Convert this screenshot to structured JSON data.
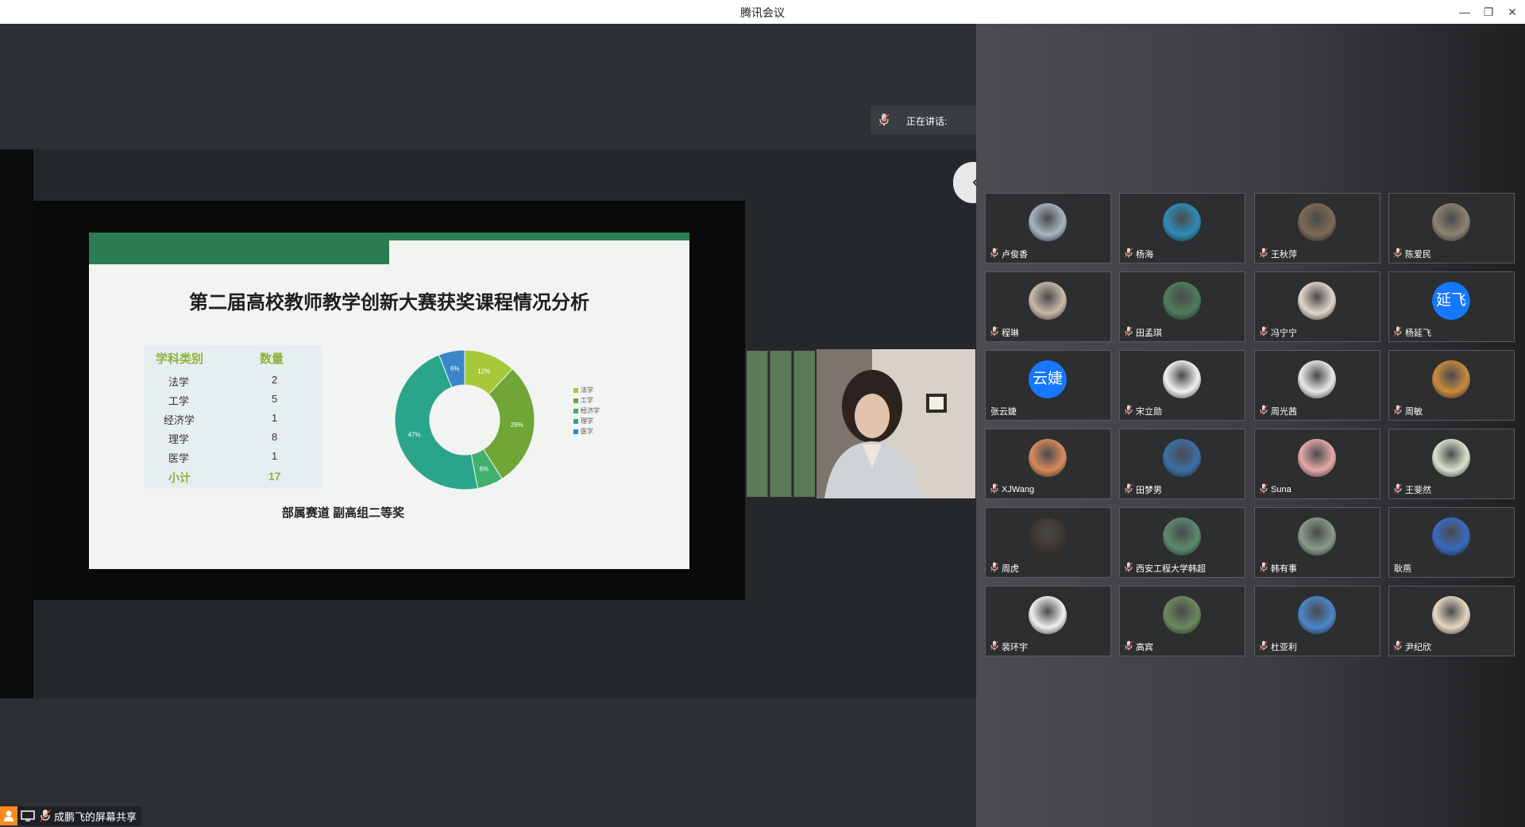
{
  "window": {
    "title": "腾讯会议",
    "minimize": "—",
    "restore": "❐",
    "close": "✕"
  },
  "speaking": {
    "label": "正在讲话:"
  },
  "slide": {
    "title": "第二届高校教师教学创新大赛获奖课程情况分析",
    "table": {
      "headers": [
        "学科类别",
        "数量"
      ],
      "rows": [
        [
          "法学",
          "2"
        ],
        [
          "工学",
          "5"
        ],
        [
          "经济学",
          "1"
        ],
        [
          "理学",
          "8"
        ],
        [
          "医学",
          "1"
        ]
      ],
      "total": [
        "小计",
        "17"
      ]
    },
    "caption": "部属赛道 副高组二等奖"
  },
  "chart_data": {
    "type": "pie",
    "categories": [
      "法学",
      "工学",
      "经济学",
      "理学",
      "医学"
    ],
    "values": [
      12,
      29,
      6,
      47,
      6
    ],
    "slice_labels": [
      "12%",
      "29%",
      "6%",
      "47%",
      "6%"
    ],
    "legend": [
      "法学",
      "工学",
      "经济学",
      "理学",
      "医学"
    ],
    "colors": [
      "#a6c93a",
      "#6fa636",
      "#3fb06e",
      "#2aa58b",
      "#3a86c8"
    ]
  },
  "participants": [
    {
      "name": "卢俊香",
      "avatar": "photo-icon",
      "color": "#a9b4c0",
      "mic": true
    },
    {
      "name": "杨海",
      "avatar": "photo-icon",
      "color": "#2f8db8",
      "mic": true
    },
    {
      "name": "王秋萍",
      "avatar": "photo-icon",
      "color": "#7d6a55",
      "mic": true
    },
    {
      "name": "陈爱民",
      "avatar": "photo-icon",
      "color": "#8e8272",
      "mic": true
    },
    {
      "name": "程琳",
      "avatar": "photo-icon",
      "color": "#c9b9a8",
      "mic": true
    },
    {
      "name": "田孟琪",
      "avatar": "photo-icon",
      "color": "#4f7c5a",
      "mic": true
    },
    {
      "name": "冯宁宁",
      "avatar": "photo-icon",
      "color": "#e2d6cc",
      "mic": true
    },
    {
      "name": "杨延飞",
      "avatar": "text",
      "text": "延飞",
      "color": "#1677ff",
      "mic": true
    },
    {
      "name": "张云婕",
      "avatar": "text",
      "text": "云婕",
      "color": "#1677ff",
      "mic": false
    },
    {
      "name": "宋立勋",
      "avatar": "photo-icon",
      "color": "#f1f1f1",
      "mic": true
    },
    {
      "name": "周光茜",
      "avatar": "photo-icon",
      "color": "#e9e9e9",
      "mic": true
    },
    {
      "name": "周敏",
      "avatar": "photo-icon",
      "color": "#c98a3f",
      "mic": true
    },
    {
      "name": "XJWang",
      "avatar": "photo-icon",
      "color": "#d98a5b",
      "mic": true
    },
    {
      "name": "田梦男",
      "avatar": "photo-icon",
      "color": "#3c6fa6",
      "mic": true
    },
    {
      "name": "Suna",
      "avatar": "photo-icon",
      "color": "#e8a8a8",
      "mic": true
    },
    {
      "name": "王斐然",
      "avatar": "photo-icon",
      "color": "#d9e4cc",
      "mic": true
    },
    {
      "name": "周虎",
      "avatar": "photo-icon",
      "color": "#3b3530",
      "mic": true
    },
    {
      "name": "西安工程大学韩超",
      "avatar": "photo-icon",
      "color": "#5e8a6e",
      "mic": true
    },
    {
      "name": "韩有事",
      "avatar": "photo-icon",
      "color": "#8a9a8a",
      "mic": true
    },
    {
      "name": "耿燕",
      "avatar": "photo-icon",
      "color": "#3a6ac0",
      "mic": false
    },
    {
      "name": "裴环宇",
      "avatar": "photo-icon",
      "color": "#f0f0f0",
      "mic": true
    },
    {
      "name": "高宾",
      "avatar": "photo-icon",
      "color": "#6b8a5e",
      "mic": true
    },
    {
      "name": "杜亚利",
      "avatar": "photo-icon",
      "color": "#4a86c8",
      "mic": true
    },
    {
      "name": "尹纪欣",
      "avatar": "photo-icon",
      "color": "#e9d8c2",
      "mic": true
    }
  ],
  "status": {
    "label": "成鹏飞的屏幕共享"
  }
}
